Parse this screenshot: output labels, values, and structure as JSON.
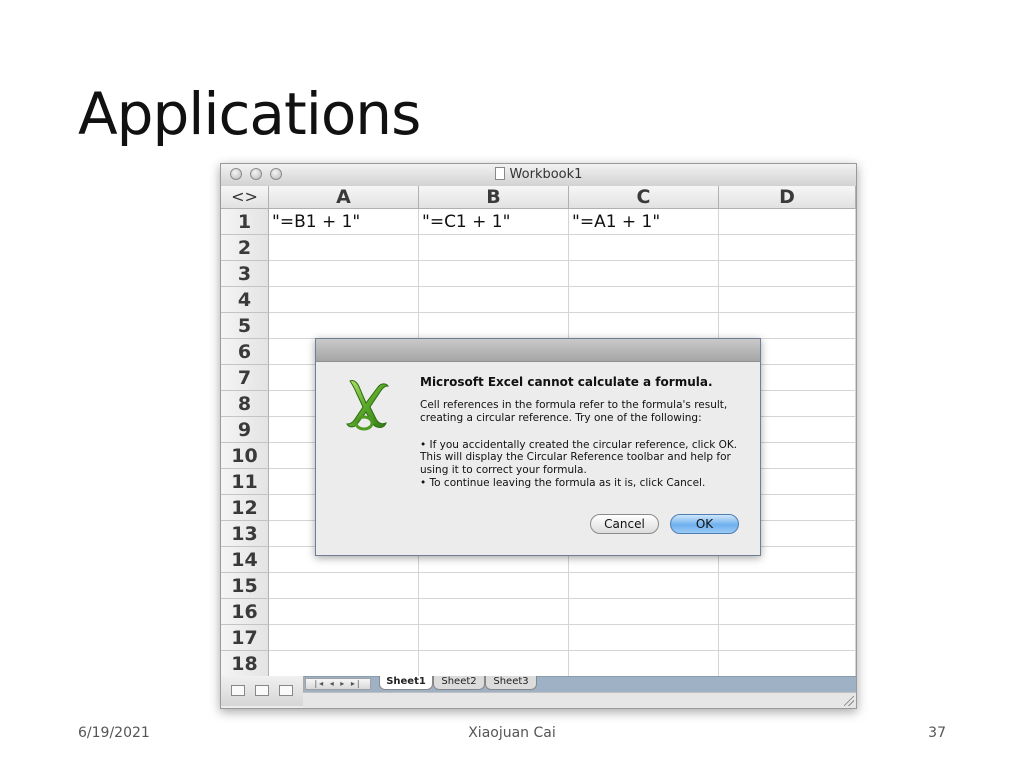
{
  "slide": {
    "title": "Applications",
    "footer_date": "6/19/2021",
    "footer_author": "Xiaojuan Cai",
    "page_number": "37"
  },
  "window": {
    "title": "Workbook1",
    "corner_glyph": "<>"
  },
  "spreadsheet": {
    "columns": [
      "A",
      "B",
      "C",
      "D"
    ],
    "rows": [
      "1",
      "2",
      "3",
      "4",
      "5",
      "6",
      "7",
      "8",
      "9",
      "10",
      "11",
      "12",
      "13",
      "14",
      "15",
      "16",
      "17",
      "18"
    ],
    "row1": [
      "\"=B1 + 1\"",
      "\"=C1 + 1\"",
      "\"=A1 + 1\"",
      ""
    ]
  },
  "sheet_tabs": [
    "Sheet1",
    "Sheet2",
    "Sheet3"
  ],
  "active_sheet": "Sheet1",
  "dialog": {
    "heading": "Microsoft Excel cannot calculate a formula.",
    "paragraph1": "Cell references in the formula refer to the formula's result, creating a circular reference. Try one of the following:",
    "bullet1": "• If you accidentally created the circular reference, click OK. This will display the Circular Reference toolbar and help for using it to correct your formula.",
    "bullet2": "• To continue leaving the formula as it is, click Cancel.",
    "cancel_label": "Cancel",
    "ok_label": "OK",
    "icon": "excel-app-icon",
    "ok_color": "#6fb0ee"
  }
}
